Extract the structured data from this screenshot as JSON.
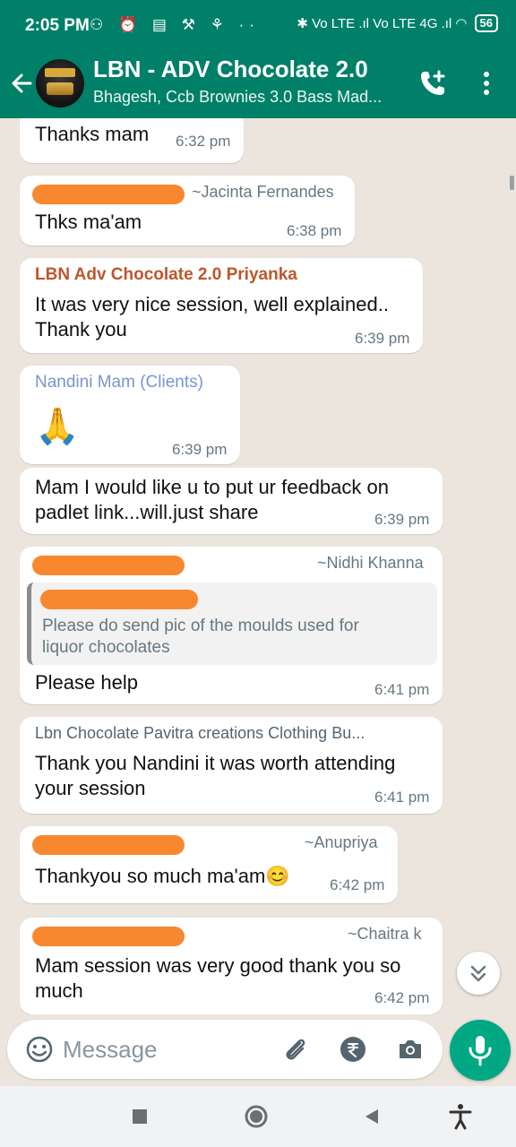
{
  "status_bar": {
    "time": "2:05 PM",
    "left_icons": "⚇ ⏰ ▤ ⚒ ⚘ ··",
    "right_icons": "✱ Vo LTE .ıl Vo LTE 4G .ıl ◠",
    "battery": "56"
  },
  "header": {
    "title": "LBN - ADV Chocolate 2.0",
    "subtitle": "Bhagesh, Ccb Brownies 3.0 Bass Mad..."
  },
  "messages": [
    {
      "text": "Thanks mam",
      "time": "6:32 pm"
    },
    {
      "alt_name": "~Jacinta Fernandes",
      "text": "Thks ma'am",
      "time": "6:38 pm"
    },
    {
      "sender": "LBN Adv Chocolate 2.0 Priyanka",
      "sender_color": "#c0552d",
      "text_line1": "It was very nice session, well explained..",
      "text_line2": "Thank you",
      "time": "6:39 pm"
    },
    {
      "sender": "Nandini Mam (Clients)",
      "sender_color": "#7b93d6",
      "emoji": "🙏",
      "time": "6:39 pm"
    },
    {
      "text_line1": "Mam I would like u to put ur feedback on",
      "text_line2": "padlet link...will.just share",
      "time": "6:39 pm"
    },
    {
      "alt_name": "~Nidhi Khanna",
      "quote_line1": "Please do send pic of the moulds used for",
      "quote_line2": "liquor chocolates",
      "text": "Please help",
      "time": "6:41 pm"
    },
    {
      "sender": "Lbn Chocolate Pavitra creations Clothing Bu...",
      "sender_color": "#54656f",
      "text_line1": "Thank you Nandini it was worth attending",
      "text_line2": "your session",
      "time": "6:41 pm"
    },
    {
      "alt_name": "~Anupriya",
      "text": "Thankyou so much ma'am😊",
      "time": "6:42 pm"
    },
    {
      "alt_name": "~Chaitra k",
      "text_line1": "Mam session was very good thank you so",
      "text_line2": "much",
      "time": "6:42 pm"
    }
  ],
  "input": {
    "placeholder": "Message"
  },
  "colors": {
    "header": "#008069",
    "accent": "#00a884",
    "redaction": "#f7882f",
    "chat_bg": "#ece5dd"
  },
  "icons": [
    "back-arrow-icon",
    "add-call-icon",
    "more-vert-icon",
    "emoji-icon",
    "attach-icon",
    "rupee-icon",
    "camera-icon",
    "mic-icon",
    "double-chevron-down-icon",
    "square-icon",
    "circle-icon",
    "triangle-back-icon",
    "accessibility-icon"
  ]
}
